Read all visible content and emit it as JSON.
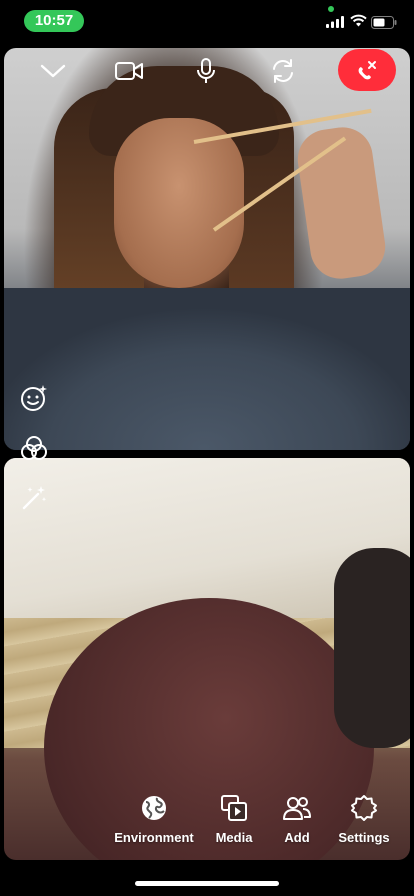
{
  "status_bar": {
    "time": "10:57",
    "camera_indicator_color": "#34c759",
    "icons": [
      "signal-icon",
      "wifi-icon",
      "battery-icon"
    ]
  },
  "top_controls": {
    "icons": [
      "chevron-down-icon",
      "video-camera-icon",
      "microphone-icon",
      "switch-camera-icon",
      "end-call-icon"
    ],
    "end_call_color": "#ff2d3a"
  },
  "side_controls": {
    "icons": [
      "face-effects-icon",
      "filters-icon",
      "beauty-wand-icon"
    ]
  },
  "toolbar": {
    "environment_label": "Environment",
    "media_label": "Media",
    "add_label": "Add",
    "settings_label": "Settings"
  }
}
